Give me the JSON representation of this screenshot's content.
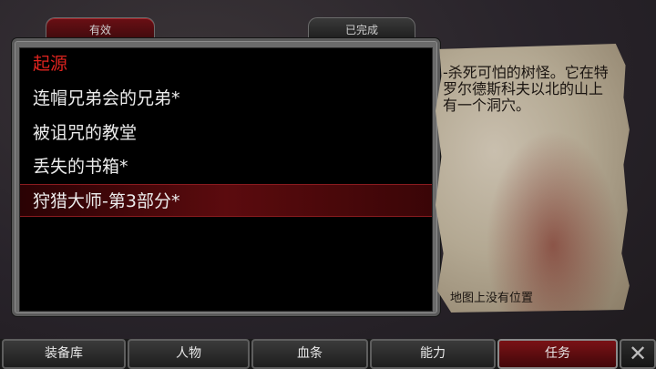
{
  "tabs": {
    "active": "有效",
    "completed": "已完成"
  },
  "quests": [
    {
      "label": "起源",
      "color": "#e0241f"
    },
    {
      "label": "连帽兄弟会的兄弟*"
    },
    {
      "label": "被诅咒的教堂"
    },
    {
      "label": "丢失的书箱*"
    },
    {
      "label": "狩猎大师-第3部分*",
      "selected": true
    }
  ],
  "detail": {
    "description": "-杀死可怕的树怪。它在特罗尔德斯科夫以北的山上有一个洞穴。",
    "location": "地图上没有位置"
  },
  "nav": {
    "items": [
      "装备库",
      "人物",
      "血条",
      "能力",
      "任务"
    ],
    "active": "任务",
    "close_icon": "close-icon"
  }
}
